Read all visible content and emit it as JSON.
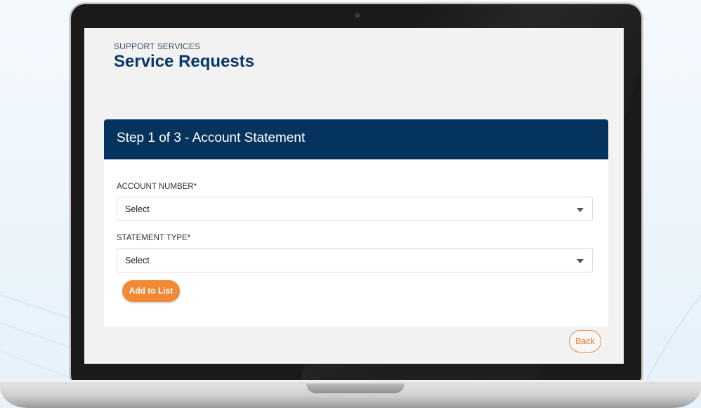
{
  "header": {
    "eyebrow": "SUPPORT SERVICES",
    "title": "Service Requests"
  },
  "card": {
    "title": "Step 1 of 3 - Account Statement",
    "fields": [
      {
        "label": "ACCOUNT NUMBER*",
        "value": "Select"
      },
      {
        "label": "STATEMENT TYPE*",
        "value": "Select"
      }
    ],
    "add_button": "Add to List"
  },
  "footer": {
    "back_button": "Back"
  },
  "colors": {
    "brand_navy": "#04345e",
    "title_navy": "#083768",
    "accent_orange": "#f08a37"
  }
}
